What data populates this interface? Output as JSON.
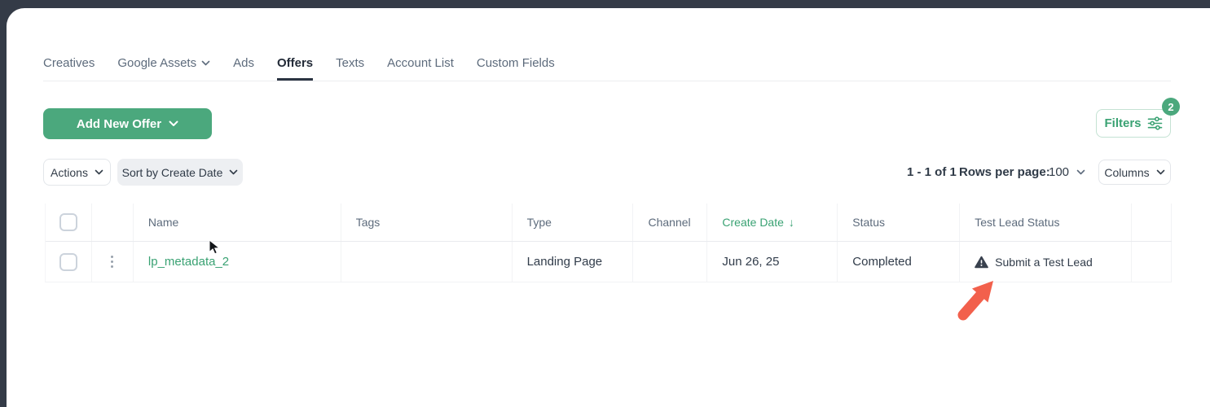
{
  "window": {
    "frame_color": "#343b47"
  },
  "tabs": [
    {
      "label": "Creatives",
      "active": false
    },
    {
      "label": "Google Assets",
      "active": false,
      "chevron": true
    },
    {
      "label": "Ads",
      "active": false
    },
    {
      "label": "Offers",
      "active": true
    },
    {
      "label": "Texts",
      "active": false
    },
    {
      "label": "Account List",
      "active": false
    },
    {
      "label": "Custom Fields",
      "active": false
    }
  ],
  "toolbar": {
    "add_button_label": "Add New Offer",
    "filters_label": "Filters",
    "filters_badge_count": "2"
  },
  "list_controls": {
    "actions_label": "Actions",
    "sort_label": "Sort by Create Date",
    "pagination_range": "1 - 1 of 1",
    "rows_per_page_label": "Rows per page:",
    "rows_per_page_value": "100",
    "columns_label": "Columns"
  },
  "table": {
    "headers": {
      "name": "Name",
      "tags": "Tags",
      "type": "Type",
      "channel": "Channel",
      "create_date": "Create Date",
      "status": "Status",
      "test_lead_status": "Test Lead Status"
    },
    "sort_column": "Create Date",
    "sort_direction": "desc",
    "rows": [
      {
        "name": "lp_metadata_2",
        "tags": "",
        "type": "Landing Page",
        "channel": "",
        "create_date": "Jun 26, 25",
        "status": "Completed",
        "test_lead_status": "Submit a Test Lead"
      }
    ]
  },
  "icons": {
    "sort_desc": "↓"
  },
  "colors": {
    "accent_green": "#4ba87d",
    "link_green": "#3aa273",
    "annotation_red": "#f2604c",
    "frame_dark": "#343b47",
    "warning_dark": "#39414e"
  }
}
